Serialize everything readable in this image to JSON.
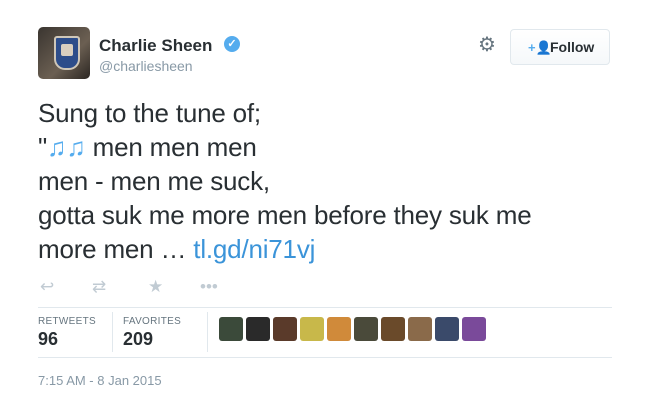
{
  "user": {
    "name": "Charlie Sheen",
    "handle": "@charliesheen",
    "verified": true,
    "avatar_icon": "avatar-photo"
  },
  "follow_button": {
    "label": "Follow",
    "icon": "add-user-icon"
  },
  "settings_icon": "gear-icon",
  "tweet": {
    "line1": "Sung to the tune of;",
    "line2_prefix": "\"",
    "line2_notes": "♫♫",
    "line2_rest": " men men men",
    "line3": "men - men me suck,",
    "line4": "gotta suk me more men before they suk me",
    "line5_text": "more men … ",
    "line5_link": "tl.gd/ni71vj"
  },
  "actions": [
    "reply-icon",
    "retweet-icon",
    "favorite-icon",
    "more-icon"
  ],
  "stats": {
    "retweets_label": "RETWEETS",
    "retweets": "96",
    "favorites_label": "FAVORITES",
    "favorites": "209"
  },
  "favoriter_avatars": [
    "#3b4a3a",
    "#2a2a2a",
    "#5a3a2a",
    "#c8b84a",
    "#d08a3a",
    "#4a4a3a",
    "#6a4a2a",
    "#8a6a4a",
    "#3a4a6a",
    "#7a4a9a"
  ],
  "timestamp": "7:15 AM - 8 Jan 2015",
  "colors": {
    "accent": "#55acee",
    "link": "#3b94d9",
    "text": "#292f33",
    "muted": "#8899a6"
  }
}
